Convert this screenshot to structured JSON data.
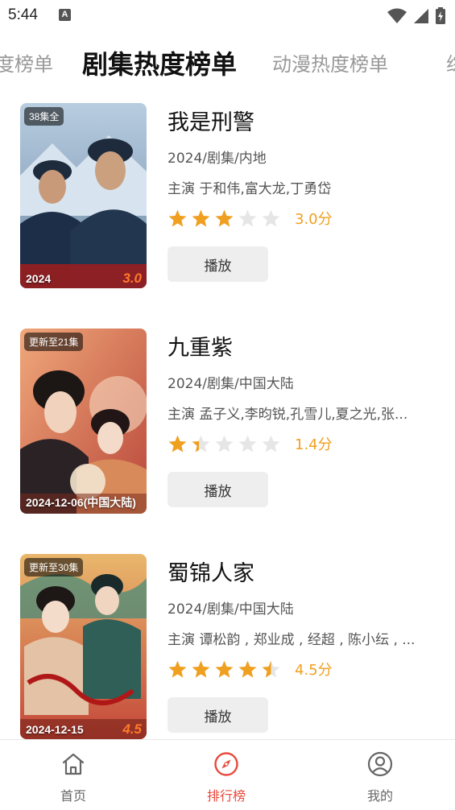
{
  "status_bar": {
    "time": "5:44",
    "notification_icon": "A"
  },
  "tabs": [
    {
      "label": "度榜单",
      "active": false
    },
    {
      "label": "剧集热度榜单",
      "active": true
    },
    {
      "label": "动漫热度榜单",
      "active": false
    },
    {
      "label": "综",
      "active": false
    }
  ],
  "items": [
    {
      "title": "我是刑警",
      "meta": "2024/剧集/内地",
      "cast": "主演 于和伟,富大龙,丁勇岱",
      "rating": 3.0,
      "score_text": "3.0分",
      "play_label": "播放",
      "poster": {
        "badge": "38集全",
        "date": "2024",
        "score": "3.0"
      }
    },
    {
      "title": "九重紫",
      "meta": "2024/剧集/中国大陆",
      "cast": "主演 孟子义,李昀锐,孔雪儿,夏之光,张...",
      "rating": 1.4,
      "score_text": "1.4分",
      "play_label": "播放",
      "poster": {
        "badge": "更新至21集",
        "date": "2024-12-06(中国大陆)",
        "score": ""
      }
    },
    {
      "title": "蜀锦人家",
      "meta": "2024/剧集/中国大陆",
      "cast": "主演 谭松韵 , 郑业成 , 经超 , 陈小纭 , ...",
      "rating": 4.5,
      "score_text": "4.5分",
      "play_label": "播放",
      "poster": {
        "badge": "更新至30集",
        "date": "2024-12-15",
        "score": "4.5"
      }
    }
  ],
  "bottom_nav": [
    {
      "label": "首页",
      "icon": "home-icon",
      "active": false
    },
    {
      "label": "排行榜",
      "icon": "compass-icon",
      "active": true
    },
    {
      "label": "我的",
      "icon": "user-icon",
      "active": false
    }
  ],
  "colors": {
    "accent": "#e8493c",
    "star": "#f0a020",
    "star_empty": "#e6e6e6",
    "score": "#f0a020"
  }
}
